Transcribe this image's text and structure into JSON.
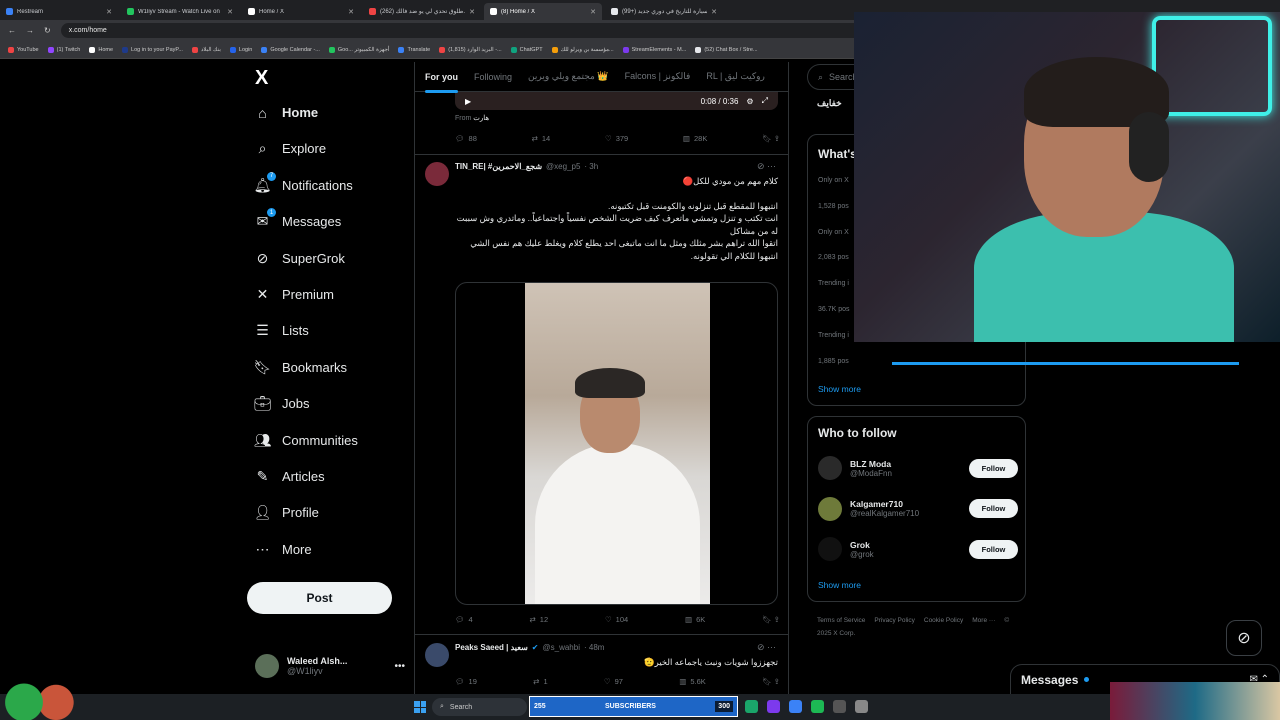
{
  "browser": {
    "tabs": [
      {
        "label": "Restream",
        "color": "#3b82f6"
      },
      {
        "label": "W1liyv Stream - Watch Live on",
        "color": "#22c55e"
      },
      {
        "label": "Home / X",
        "color": "#ffffff"
      },
      {
        "label": "(262) طلوق تحدي لي يو ضد فالك...",
        "color": "#ef4444"
      },
      {
        "label": "(8) Home / X",
        "color": "#ffffff",
        "active": true
      },
      {
        "label": "(99+) سيارة للتاريخ في دوري جديد",
        "color": "#e5e7eb"
      }
    ],
    "url": "x.com/home",
    "bookmarks": [
      "YouTube",
      "(1) Twitch",
      "Home",
      "Log in to your PayP...",
      "بنك البلاد",
      "Login",
      "Google Calendar -...",
      "Goo... أجهزة الكمبيوتر",
      "Translate",
      "(1,815) البريد الوارد -...",
      "ChatGPT",
      "مؤسسة بن ويرلو للك...",
      "StreamElements - M...",
      "(52) Chat Box / Stre..."
    ]
  },
  "sidebar": {
    "logo": "X",
    "items": [
      {
        "label": "Home",
        "icon": "home-icon",
        "glyph": "⌂",
        "badge": ""
      },
      {
        "label": "Explore",
        "icon": "search-icon",
        "glyph": "⌕",
        "badge": ""
      },
      {
        "label": "Notifications",
        "icon": "bell-icon",
        "glyph": "🔔︎",
        "badge": "7"
      },
      {
        "label": "Messages",
        "icon": "envelope-icon",
        "glyph": "✉",
        "badge": "1"
      },
      {
        "label": "SuperGrok",
        "icon": "grok-icon",
        "glyph": "⊘",
        "badge": ""
      },
      {
        "label": "Premium",
        "icon": "x-premium-icon",
        "glyph": "✕",
        "badge": ""
      },
      {
        "label": "Lists",
        "icon": "list-icon",
        "glyph": "☰",
        "badge": ""
      },
      {
        "label": "Bookmarks",
        "icon": "bookmark-icon",
        "glyph": "🔖︎",
        "badge": ""
      },
      {
        "label": "Jobs",
        "icon": "briefcase-icon",
        "glyph": "💼︎",
        "badge": ""
      },
      {
        "label": "Communities",
        "icon": "people-icon",
        "glyph": "👥︎",
        "badge": ""
      },
      {
        "label": "Articles",
        "icon": "article-icon",
        "glyph": "✎",
        "badge": ""
      },
      {
        "label": "Profile",
        "icon": "user-icon",
        "glyph": "👤︎",
        "badge": ""
      },
      {
        "label": "More",
        "icon": "more-circle-icon",
        "glyph": "⋯",
        "badge": ""
      }
    ],
    "post_label": "Post",
    "account": {
      "name": "Waleed Alsh...",
      "handle": "@W1liyv"
    }
  },
  "feed": {
    "tabs": [
      "For you",
      "Following",
      "مجتمع ويلي ويرين 👑",
      "Falcons | فالكونز",
      "RL | روكيت ليق"
    ],
    "video_time": "0:08 / 0:36",
    "from_label": "From",
    "from_name": "هارت",
    "tweet0_stats": {
      "replies": "88",
      "retweets": "14",
      "likes": "379",
      "views": "28K"
    },
    "tweet1": {
      "name": "TIN_RE| #شجع_الاحمرين",
      "handle": "@xeg_p5",
      "time": "· 3h",
      "lines": [
        "كلام مهم من مودي للكل🔴",
        "",
        "انتبهوا للمقطع قبل تنزلونه والكومنت قبل تكتبونه.",
        "انت تكتب و تنزل وتمشي ماتعرف كيف ضريت الشخص نفسياً واجتماعياً.. وماتدري وش سببت له من مشاكل",
        "اتقوا الله تراهم بشر مثلك ومثل ما انت ماتبغى احد يطلع كلام ويغلط عليك هم نفس الشي",
        "انتبهوا للكلام الي تقولونه."
      ],
      "stats": {
        "replies": "4",
        "retweets": "12",
        "likes": "104",
        "views": "6K"
      }
    },
    "tweet2": {
      "name": "Peaks Saeed | سعيد",
      "handle": "@s_wahbi",
      "time": "· 48m",
      "text": "تجهززوا شويات ونبث ياجماعه الخير🫡",
      "stats": {
        "replies": "19",
        "retweets": "1",
        "likes": "97",
        "views": "5.6K"
      }
    }
  },
  "right": {
    "search_placeholder": "Search",
    "trend_top": "خفايف",
    "whats_title": "What's",
    "trend_rows": [
      "Only on X",
      "1,528 pos",
      "Only on X",
      "2,083 pos",
      "Trending i",
      "36.7K pos",
      "Trending i",
      "1,885 pos"
    ],
    "show_more": "Show more",
    "who_title": "Who to follow",
    "follow": [
      {
        "name": "BLZ Moda",
        "handle": "@ModaFnn",
        "color": "#2a2a2a"
      },
      {
        "name": "Kalgamer710",
        "handle": "@realKalgamer710",
        "color": "#6e7a3a"
      },
      {
        "name": "Grok",
        "handle": "@grok",
        "color": "#111111"
      }
    ],
    "follow_label": "Follow",
    "show_more2": "Show more",
    "footer": [
      "Terms of Service",
      "Privacy Policy",
      "Cookie Policy",
      "More ···",
      "© 2025 X Corp."
    ]
  },
  "messages_dock": {
    "label": "Messages"
  },
  "taskbar": {
    "search": "Search",
    "subs_count": "255",
    "subs_label": "SUBSCRIBERS",
    "subs_goal": "300"
  },
  "colors": {
    "accent": "#1d9bf0",
    "background": "#000000",
    "border": "#2f3336"
  }
}
